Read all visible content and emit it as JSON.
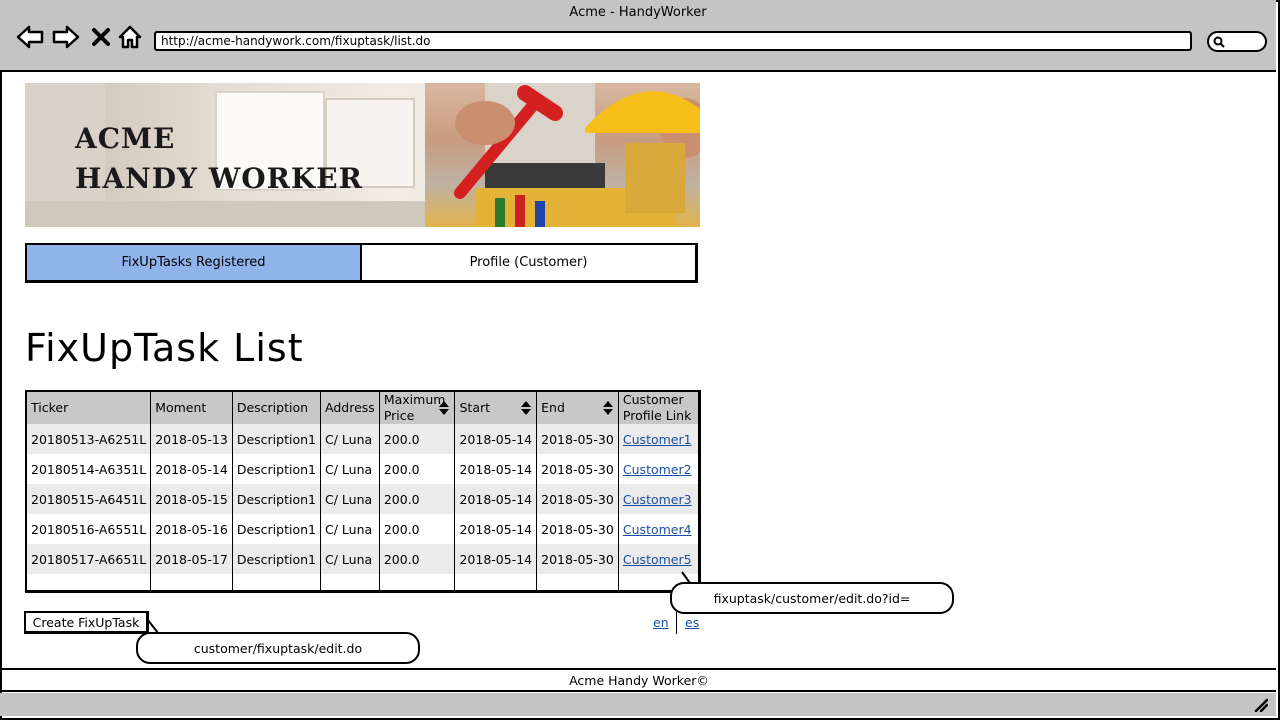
{
  "window": {
    "title": "Acme - HandyWorker",
    "url": "http://acme-handywork.com/fixuptask/list.do"
  },
  "banner": {
    "line1": "ACME",
    "line2": "HANDY WORKER"
  },
  "tabs": [
    {
      "label": "FixUpTasks Registered",
      "active": true
    },
    {
      "label": "Profile (Customer)",
      "active": false
    }
  ],
  "page": {
    "title": "FixUpTask List"
  },
  "table": {
    "headers": {
      "ticker": "Ticker",
      "moment": "Moment",
      "description": "Description",
      "address": "Address",
      "max_price_1": "Maximum",
      "max_price_2": "Price",
      "start": "Start",
      "end": "End",
      "customer_1": "Customer",
      "customer_2": "Profile Link"
    },
    "rows": [
      {
        "ticker": "20180513-A6251L",
        "moment": "2018-05-13",
        "description": "Description1",
        "address": "C/ Luna",
        "price": "200.0",
        "start": "2018-05-14",
        "end": "2018-05-30",
        "customer": "Customer1"
      },
      {
        "ticker": "20180514-A6351L",
        "moment": "2018-05-14",
        "description": "Description1",
        "address": "C/ Luna",
        "price": "200.0",
        "start": "2018-05-14",
        "end": "2018-05-30",
        "customer": "Customer2"
      },
      {
        "ticker": "20180515-A6451L",
        "moment": "2018-05-15",
        "description": "Description1",
        "address": "C/ Luna",
        "price": "200.0",
        "start": "2018-05-14",
        "end": "2018-05-30",
        "customer": "Customer3"
      },
      {
        "ticker": "20180516-A6551L",
        "moment": "2018-05-16",
        "description": "Description1",
        "address": "C/ Luna",
        "price": "200.0",
        "start": "2018-05-14",
        "end": "2018-05-30",
        "customer": "Customer4"
      },
      {
        "ticker": "20180517-A6651L",
        "moment": "2018-05-17",
        "description": "Description1",
        "address": "C/ Luna",
        "price": "200.0",
        "start": "2018-05-14",
        "end": "2018-05-30",
        "customer": "Customer5"
      }
    ]
  },
  "actions": {
    "create_label": "Create FixUpTask"
  },
  "annotations": {
    "customer_link": "fixuptask/customer/edit.do?id=",
    "create_link": "customer/fixuptask/edit.do"
  },
  "languages": {
    "en": "en",
    "es": "es"
  },
  "footer": {
    "text": "Acme Handy Worker©"
  },
  "colors": {
    "active_tab": "#8fb3ea",
    "header_bg": "#c8c8c8",
    "link": "#1a4fa0"
  },
  "icons": [
    "back-arrow-icon",
    "forward-arrow-icon",
    "close-icon",
    "home-icon",
    "search-icon",
    "sort-icon",
    "resize-grip-icon"
  ]
}
